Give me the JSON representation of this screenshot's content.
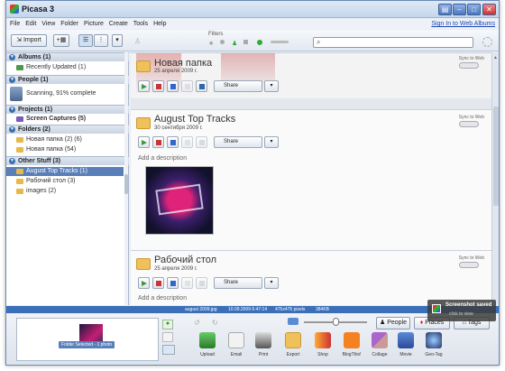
{
  "window": {
    "title": "Picasa 3",
    "sign_in": "Sign In to Web Albums"
  },
  "menu": [
    "File",
    "Edit",
    "View",
    "Folder",
    "Picture",
    "Create",
    "Tools",
    "Help"
  ],
  "toolbar": {
    "import_label": "Import",
    "filters_label": "Filters",
    "search_value": ""
  },
  "sidebar": {
    "sections": [
      {
        "label": "Albums (1)",
        "items": [
          "Recently Updated (1)"
        ]
      },
      {
        "label": "People (1)",
        "items": [
          "Scanning, 91% complete"
        ]
      },
      {
        "label": "Projects (1)",
        "items": [
          "Screen Captures (5)"
        ]
      },
      {
        "label": "Folders (2)",
        "items": [
          "Новая папка (2) (6)",
          "Новая папка (54)"
        ]
      },
      {
        "label": "Other Stuff (3)",
        "items": [
          "August Top Tracks (1)",
          "Рабочий стол (3)",
          "images (2)"
        ]
      }
    ]
  },
  "albums": [
    {
      "title": "Новая папка",
      "date": "25 апреля 2009 г.",
      "sync_label": "Sync to Web",
      "share_label": "Share"
    },
    {
      "title": "August Top Tracks",
      "date": "30 сентября 2009 г.",
      "sync_label": "Sync to Web",
      "share_label": "Share",
      "description_placeholder": "Add a description"
    },
    {
      "title": "Рабочий стол",
      "date": "25 апреля 2009 г.",
      "sync_label": "Sync to Web",
      "share_label": "Share",
      "description_placeholder": "Add a description"
    }
  ],
  "status_bar": {
    "filename": "august 2009.jpg",
    "datetime": "10.09.2009 6:47:14",
    "dimensions": "475x475 pixels",
    "filesize": "384KB"
  },
  "tray": {
    "label": "Folder Selected - 1 photo"
  },
  "bottom_buttons": [
    "Upload",
    "Email",
    "Print",
    "Export",
    "Shop",
    "BlogThis!",
    "Collage",
    "Movie",
    "Geo-Tag"
  ],
  "people_button": "People",
  "places_button": "Places",
  "tags_button": "Tags",
  "toast": {
    "title": "Screenshot saved",
    "subtitle": "click to view"
  },
  "colors": {
    "accent": "#3b70b8",
    "selection": "#5a7fb8",
    "folder": "#f0c05a"
  }
}
